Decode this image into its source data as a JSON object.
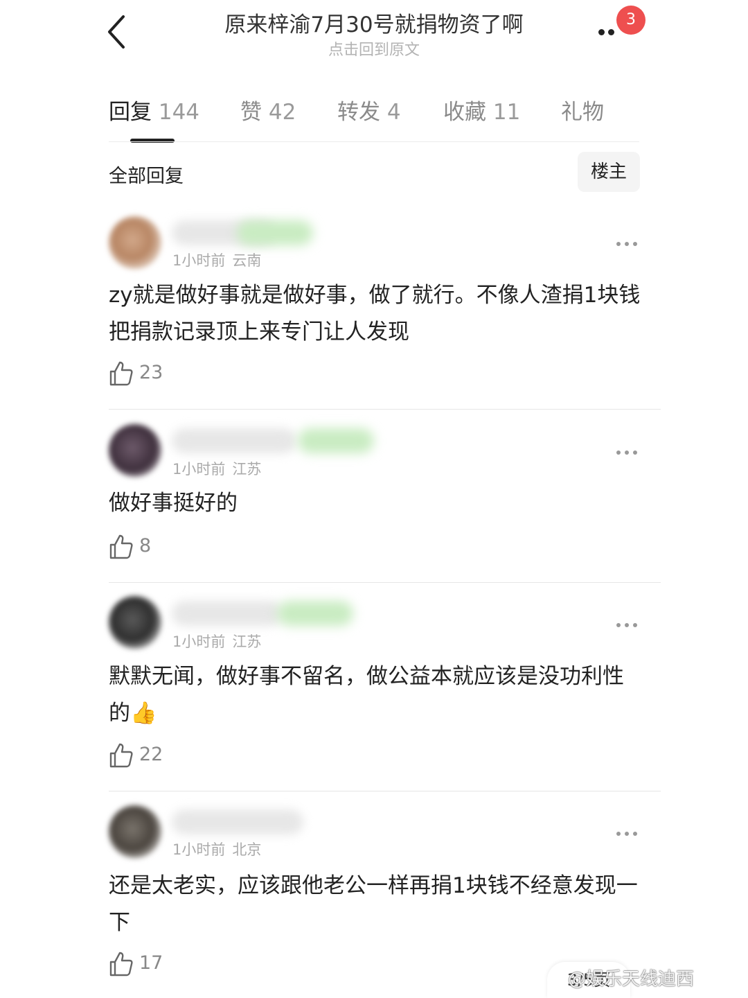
{
  "header": {
    "title": "原来梓渝7月30号就捐物资了啊",
    "subtitle": "点击回到原文",
    "notification_badge": "3"
  },
  "tabs": [
    {
      "label": "回复",
      "count": "144"
    },
    {
      "label": "赞",
      "count": "42"
    },
    {
      "label": "转发",
      "count": "4"
    },
    {
      "label": "收藏",
      "count": "11"
    },
    {
      "label": "礼物",
      "count": ""
    }
  ],
  "section": {
    "title": "全部回复",
    "owner_filter": "楼主"
  },
  "comments": [
    {
      "time": "1小时前",
      "location": "云南",
      "text": "zy就是做好事就是做好事，做了就行。不像人渣捐1块钱把捐款记录顶上来专门让人发现",
      "likes": "23"
    },
    {
      "time": "1小时前",
      "location": "江苏",
      "text": "做好事挺好的",
      "likes": "8"
    },
    {
      "time": "1小时前",
      "location": "江苏",
      "text": "默默无闻，做好事不留名，做公益本就应该是没功利性的👍",
      "likes": "22"
    },
    {
      "time": "1小时前",
      "location": "北京",
      "text": "还是太老实，应该跟他老公一样再捐1块钱不经意发现一下",
      "likes": "17"
    }
  ],
  "page_indicator": "3/5页",
  "watermark": "@娱乐天线迪西",
  "colors": {
    "badge": "#ee4f4f",
    "tag_green": "#c9ecc2",
    "meta_gray": "#aaaaaa"
  }
}
